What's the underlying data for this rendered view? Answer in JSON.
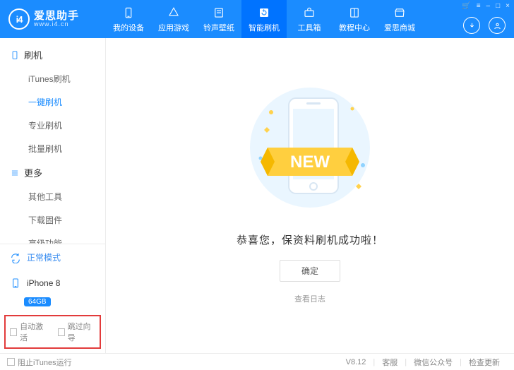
{
  "brand": {
    "logo_text": "i4",
    "name": "爱思助手",
    "url": "www.i4.cn"
  },
  "nav": {
    "items": [
      {
        "id": "device",
        "label": "我的设备"
      },
      {
        "id": "apps",
        "label": "应用游戏"
      },
      {
        "id": "ring",
        "label": "铃声壁纸"
      },
      {
        "id": "flash",
        "label": "智能刷机",
        "active": true
      },
      {
        "id": "toolbox",
        "label": "工具箱"
      },
      {
        "id": "tutorial",
        "label": "教程中心"
      },
      {
        "id": "store",
        "label": "爱思商城"
      }
    ]
  },
  "win_controls": {
    "cart": "🛒",
    "menu": "≡",
    "min": "–",
    "max": "□",
    "close": "×"
  },
  "sidebar": {
    "groups": [
      {
        "id": "flash",
        "title": "刷机",
        "items": [
          {
            "id": "itunes",
            "label": "iTunes刷机"
          },
          {
            "id": "onekey",
            "label": "一键刷机",
            "active": true
          },
          {
            "id": "pro",
            "label": "专业刷机"
          },
          {
            "id": "batch",
            "label": "批量刷机"
          }
        ]
      },
      {
        "id": "more",
        "title": "更多",
        "items": [
          {
            "id": "other",
            "label": "其他工具"
          },
          {
            "id": "fw",
            "label": "下载固件"
          },
          {
            "id": "adv",
            "label": "高级功能"
          }
        ]
      }
    ],
    "mode_label": "正常模式",
    "device_name": "iPhone 8",
    "device_storage": "64GB",
    "check_auto_activate": "自动激活",
    "check_skip_guide": "跳过向导"
  },
  "main": {
    "banner_word": "NEW",
    "success_msg": "恭喜您，保资料刷机成功啦！",
    "ok_label": "确定",
    "view_log_label": "查看日志"
  },
  "footer": {
    "block_itunes": "阻止iTunes运行",
    "version": "V8.12",
    "support": "客服",
    "wechat": "微信公众号",
    "update": "检查更新"
  }
}
